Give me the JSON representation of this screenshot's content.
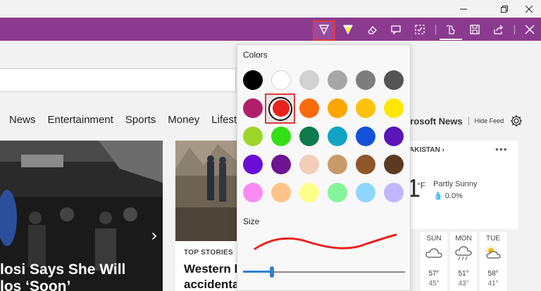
{
  "window": {
    "controls": [
      "minimize-icon",
      "restore-icon",
      "close-icon"
    ]
  },
  "toolbar": {
    "accent_color": "#8a3b8f",
    "tools": [
      "ballpoint-pen-icon",
      "highlighter-icon",
      "eraser-icon",
      "add-note-icon",
      "clip-icon",
      "touch-writing-icon",
      "save-icon",
      "share-icon",
      "exit-icon"
    ],
    "active_tool": "ballpoint-pen-icon"
  },
  "page": {
    "nav": [
      "News",
      "Entertainment",
      "Sports",
      "Money",
      "Lifestyle"
    ],
    "hero": {
      "title_line1": "losi Says She Will",
      "title_line2": "los ‘Soon’"
    },
    "story": {
      "tag": "TOP STORIES",
      "title_line1": "Western le",
      "title_line2": "accidentall"
    },
    "feed": {
      "source": "crosoft News",
      "hide_feed": "Hide Feed"
    },
    "weather": {
      "location": "AKISTAN ›",
      "more": "•••",
      "temp": "1",
      "unit": "°F",
      "condition": "Partly Sunny",
      "precip_icon": "💧",
      "precip": "0.0%",
      "forecast": [
        {
          "day": "SUN",
          "hi": "57°",
          "lo": "45°",
          "icon": "cloudy-icon"
        },
        {
          "day": "MON",
          "hi": "51°",
          "lo": "43°",
          "icon": "rain-icon"
        },
        {
          "day": "TUE",
          "hi": "58°",
          "lo": "41°",
          "icon": "partly-sunny-icon"
        }
      ]
    }
  },
  "flyout": {
    "colors_label": "Colors",
    "size_label": "Size",
    "selected_color": "#e8231d",
    "colors": [
      "#000000",
      "#ffffff",
      "#d2d2d2",
      "#a6a6a6",
      "#7d7d7d",
      "#555555",
      "#b0206a",
      "#e8231d",
      "#fa6b0c",
      "#ffa500",
      "#ffc20c",
      "#ffe600",
      "#9ed52b",
      "#35df15",
      "#0d7a4b",
      "#13a3c7",
      "#1453d9",
      "#5b15b8",
      "#6a0ed6",
      "#6e1392",
      "#f2cdb8",
      "#c79a6a",
      "#8f5628",
      "#5c3a22",
      "#fb8bf0",
      "#ffc38a",
      "#ffff8a",
      "#85f59b",
      "#8fd6ff",
      "#c3b5ff"
    ],
    "size_fraction": 0.18
  }
}
